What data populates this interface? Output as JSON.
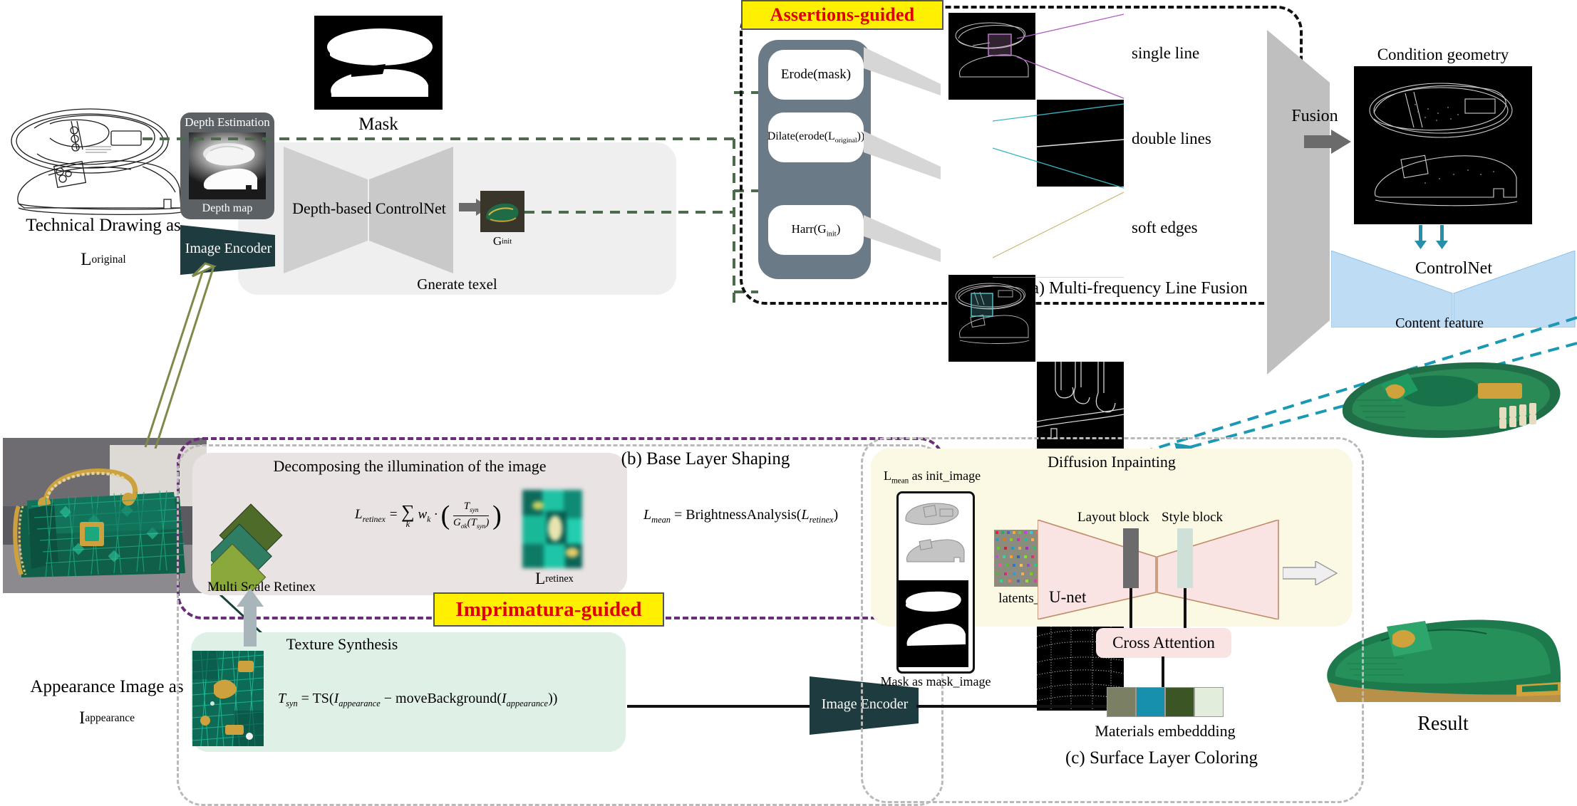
{
  "figure": {
    "left_input": {
      "caption_line1": "Technical Drawing as",
      "caption_line2_base": "L",
      "caption_line2_sub": "original"
    },
    "appearance": {
      "caption_line1": "Appearance Image as",
      "caption_line2_base": "I",
      "caption_line2_sub": "appearance"
    },
    "depth": {
      "title": "Depth Estimation",
      "image_caption": "Depth map"
    },
    "encoder_label": "Image Encoder",
    "controlnet_depth_label": "Depth-based ControlNet",
    "generate_texel_label": "Gnerate texel",
    "g_init": {
      "base": "G",
      "sub": "init"
    },
    "mask_label": "Mask",
    "assertions_badge": "Assertions-guided",
    "imprimatura_badge": "Imprimatura-guided",
    "operations": [
      {
        "text": "Erode(mask)"
      },
      {
        "text": "Dilate(erode(L",
        "sub": "original",
        "tail": "))"
      },
      {
        "text": "Harr(G",
        "sub": "init",
        "tail": ")"
      }
    ],
    "edge_rows": [
      {
        "label": "single line"
      },
      {
        "label": "double lines"
      },
      {
        "label": "soft edges"
      }
    ],
    "panel_a_caption": "(a) Multi-frequency Line Fusion",
    "fusion_label": "Fusion",
    "condition_geometry_label": "Condition geometry",
    "controlnet_label": "ControlNet",
    "content_feature_label": "Content feature",
    "result_label": "Result",
    "panel_b": {
      "caption": "(b) Base Layer Shaping",
      "decompose_title": "Decomposing the illumination of the image",
      "msr_label": "Multi Scale Retinex",
      "retinex_label_base": "L",
      "retinex_label_sub": "retinex",
      "formula_retinex": "L_retinex = Σ_k w_k · ( T_syn / G_σk(T_syn) )",
      "formula_mean": "L_mean = BrightnessAnalysis(L_retinex)"
    },
    "panel_c": {
      "caption": "(c) Surface Layer Coloring",
      "diffusion_title": "Diffusion Inpainting",
      "init_image_label_base": "L",
      "init_image_label_sub": "mean",
      "init_image_label_tail": "as init_image",
      "mask_image_label": "Mask as mask_image",
      "latents_label": "latents_output",
      "unet_label": "U-net",
      "layout_block_label": "Layout block",
      "style_block_label": "Style block",
      "cross_attention_label": "Cross Attention",
      "materials_label": "Materials embeddding",
      "materials_colors": [
        "#7b8064",
        "#1790ad",
        "#3b5524",
        "#e2eedb"
      ]
    },
    "texture": {
      "title": "Texture Synthesis",
      "formula": "T_syn = TS(I_appearance − moveBackground(I_appearance))"
    },
    "colors": {
      "assertions_badge_bg": "#ffef00",
      "assertions_badge_fg": "#e00000",
      "panel_blue": "#bfdcf5",
      "panel_pink": "#f9e3e3",
      "panel_cream": "#fbf8e3",
      "encoder_dark": "#1e3b3f",
      "op_panel": "#6b7a87",
      "teal_dash": "#1a99b5",
      "green_dash": "#4c6b4c",
      "purple_dash": "#6b2d7a"
    }
  }
}
